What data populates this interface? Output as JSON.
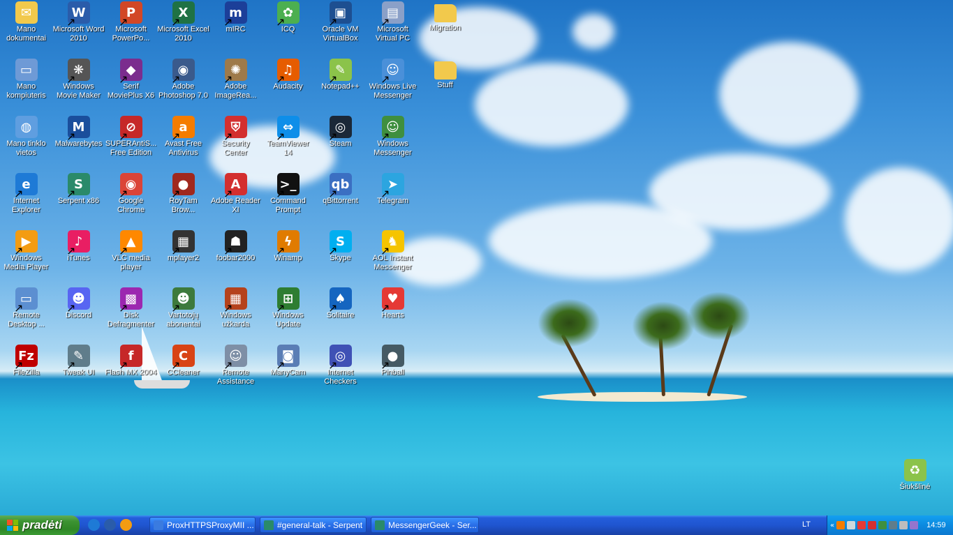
{
  "desktop": {
    "icons": [
      {
        "label": "Mano dokumentai",
        "icon": "folder-documents-icon",
        "color": "#f2c94c",
        "glyph": "✉"
      },
      {
        "label": "Microsoft Word 2010",
        "icon": "word-icon",
        "color": "#2a5caa",
        "glyph": "W"
      },
      {
        "label": "Microsoft PowerPo...",
        "icon": "powerpoint-icon",
        "color": "#d24726",
        "glyph": "P"
      },
      {
        "label": "Microsoft Excel 2010",
        "icon": "excel-icon",
        "color": "#1f7244",
        "glyph": "X"
      },
      {
        "label": "mIRC",
        "icon": "mirc-icon",
        "color": "#1c3f99",
        "glyph": "m"
      },
      {
        "label": "ICQ",
        "icon": "icq-icon",
        "color": "#4caf50",
        "glyph": "✿"
      },
      {
        "label": "Oracle VM VirtualBox",
        "icon": "virtualbox-icon",
        "color": "#1d4f91",
        "glyph": "▣"
      },
      {
        "label": "Microsoft Virtual PC",
        "icon": "virtual-pc-icon",
        "color": "#8aa0c8",
        "glyph": "▤"
      },
      {
        "label": "Migration",
        "icon": "folder-icon",
        "color": "#f2c94c",
        "glyph": ""
      },
      {
        "label": "Mano kompiuteris",
        "icon": "my-computer-icon",
        "color": "#6e9ad6",
        "glyph": "▭"
      },
      {
        "label": "Windows Movie Maker",
        "icon": "movie-maker-icon",
        "color": "#555555",
        "glyph": "❋"
      },
      {
        "label": "Serif MoviePlus X6",
        "icon": "movieplus-icon",
        "color": "#7b2d8e",
        "glyph": "◆"
      },
      {
        "label": "Adobe Photoshop 7.0",
        "icon": "photoshop-icon",
        "color": "#3a5a8c",
        "glyph": "◉"
      },
      {
        "label": "Adobe ImageRea...",
        "icon": "imageready-icon",
        "color": "#9e7a4a",
        "glyph": "✺"
      },
      {
        "label": "Audacity",
        "icon": "audacity-icon",
        "color": "#e65c00",
        "glyph": "♫"
      },
      {
        "label": "Notepad++",
        "icon": "notepadpp-icon",
        "color": "#8bc34a",
        "glyph": "✎"
      },
      {
        "label": "Windows Live Messenger",
        "icon": "live-messenger-icon",
        "color": "#4a90d9",
        "glyph": "☺"
      },
      {
        "label": "Stuff",
        "icon": "folder-icon",
        "color": "#f2c94c",
        "glyph": ""
      },
      {
        "label": "Mano tinklo vietos",
        "icon": "network-places-icon",
        "color": "#5f9ee0",
        "glyph": "◍"
      },
      {
        "label": "Malwarebytes",
        "icon": "malwarebytes-icon",
        "color": "#1a4e9c",
        "glyph": "M"
      },
      {
        "label": "SUPERAntiS... Free Edition",
        "icon": "superantispyware-icon",
        "color": "#c62828",
        "glyph": "⊘"
      },
      {
        "label": "Avast Free Antivirus",
        "icon": "avast-icon",
        "color": "#f57c00",
        "glyph": "a"
      },
      {
        "label": "Security Center",
        "icon": "security-center-icon",
        "color": "#d32f2f",
        "glyph": "⛨"
      },
      {
        "label": "TeamViewer 14",
        "icon": "teamviewer-icon",
        "color": "#0e8ee9",
        "glyph": "⇔"
      },
      {
        "label": "Steam",
        "icon": "steam-icon",
        "color": "#1b2838",
        "glyph": "◎"
      },
      {
        "label": "Windows Messenger",
        "icon": "windows-messenger-icon",
        "color": "#3f8f3f",
        "glyph": "☺"
      },
      {
        "label": "Internet Explorer",
        "icon": "internet-explorer-icon",
        "color": "#1e7ad6",
        "glyph": "e"
      },
      {
        "label": "Serpent x86",
        "icon": "serpent-icon",
        "color": "#2a8a6a",
        "glyph": "S"
      },
      {
        "label": "Google Chrome",
        "icon": "chrome-icon",
        "color": "#db4437",
        "glyph": "◉"
      },
      {
        "label": "RoyTam Brow...",
        "icon": "roytam-browser-icon",
        "color": "#a0281e",
        "glyph": "●"
      },
      {
        "label": "Adobe Reader XI",
        "icon": "adobe-reader-icon",
        "color": "#d32f2f",
        "glyph": "A"
      },
      {
        "label": "Command Prompt",
        "icon": "command-prompt-icon",
        "color": "#111111",
        "glyph": ">_"
      },
      {
        "label": "qBittorrent",
        "icon": "qbittorrent-icon",
        "color": "#3b6fc2",
        "glyph": "qb"
      },
      {
        "label": "Telegram",
        "icon": "telegram-icon",
        "color": "#2ca5e0",
        "glyph": "➤"
      },
      {
        "label": "Windows Media Player",
        "icon": "media-player-icon",
        "color": "#f39c12",
        "glyph": "▶"
      },
      {
        "label": "iTunes",
        "icon": "itunes-icon",
        "color": "#e91e63",
        "glyph": "♪"
      },
      {
        "label": "VLC media player",
        "icon": "vlc-icon",
        "color": "#ff8800",
        "glyph": "▲"
      },
      {
        "label": "mplayer2",
        "icon": "mplayer2-icon",
        "color": "#333333",
        "glyph": "▦"
      },
      {
        "label": "foobar2000",
        "icon": "foobar2000-icon",
        "color": "#222222",
        "glyph": "☗"
      },
      {
        "label": "Winamp",
        "icon": "winamp-icon",
        "color": "#e07b00",
        "glyph": "ϟ"
      },
      {
        "label": "Skype",
        "icon": "skype-icon",
        "color": "#00aff0",
        "glyph": "S"
      },
      {
        "label": "AOL Instant Messenger",
        "icon": "aim-icon",
        "color": "#f5c400",
        "glyph": "♞"
      },
      {
        "label": "Remote Desktop ...",
        "icon": "remote-desktop-icon",
        "color": "#5c8fd1",
        "glyph": "▭"
      },
      {
        "label": "Discord",
        "icon": "discord-icon",
        "color": "#5865f2",
        "glyph": "☻"
      },
      {
        "label": "Disk Defragmenter",
        "icon": "defragmenter-icon",
        "color": "#9c27b0",
        "glyph": "▩"
      },
      {
        "label": "Vartotojų abonentai",
        "icon": "user-accounts-icon",
        "color": "#3d7a3d",
        "glyph": "☻"
      },
      {
        "label": "Windows užkarda",
        "icon": "firewall-icon",
        "color": "#b5421c",
        "glyph": "▦"
      },
      {
        "label": "Windows Update",
        "icon": "windows-update-icon",
        "color": "#2e7d32",
        "glyph": "⊞"
      },
      {
        "label": "Solitaire",
        "icon": "solitaire-icon",
        "color": "#1565c0",
        "glyph": "♠"
      },
      {
        "label": "Hearts",
        "icon": "hearts-icon",
        "color": "#e53935",
        "glyph": "♥"
      },
      {
        "label": "FileZilla",
        "icon": "filezilla-icon",
        "color": "#bf0000",
        "glyph": "Fz"
      },
      {
        "label": "Tweak UI",
        "icon": "tweak-ui-icon",
        "color": "#607d8b",
        "glyph": "✎"
      },
      {
        "label": "Flash MX 2004",
        "icon": "flash-icon",
        "color": "#c62828",
        "glyph": "f"
      },
      {
        "label": "CCleaner",
        "icon": "ccleaner-icon",
        "color": "#d84315",
        "glyph": "C"
      },
      {
        "label": "Remote Assistance",
        "icon": "remote-assistance-icon",
        "color": "#7e8fa6",
        "glyph": "☺"
      },
      {
        "label": "ManyCam",
        "icon": "manycam-icon",
        "color": "#5a7db5",
        "glyph": "◙"
      },
      {
        "label": "Internet Checkers",
        "icon": "internet-checkers-icon",
        "color": "#3f51b5",
        "glyph": "◎"
      },
      {
        "label": "Pinball",
        "icon": "pinball-icon",
        "color": "#455a64",
        "glyph": "●"
      },
      {
        "label": "Šiukšlinė",
        "icon": "recycle-bin-icon",
        "color": "#8bc34a",
        "glyph": "♻"
      }
    ]
  },
  "taskbar": {
    "start_label": "pradėti",
    "quick_launch": [
      {
        "icon": "internet-explorer-icon",
        "color": "#1e7ad6"
      },
      {
        "icon": "outlook-express-icon",
        "color": "#2a5caa"
      },
      {
        "icon": "media-player-icon",
        "color": "#f39c12"
      }
    ],
    "tasks": [
      {
        "label": "ProxHTTPSProxyMII ...",
        "icon": "app-window-icon",
        "color": "#3a7be0"
      },
      {
        "label": "#general-talk - Serpent",
        "icon": "serpent-icon",
        "color": "#2a8a6a"
      },
      {
        "label": "MessengerGeek - Ser...",
        "icon": "serpent-icon",
        "color": "#2a8a6a"
      }
    ],
    "language": "LT",
    "tray_icons": [
      {
        "icon": "avast-tray-icon",
        "color": "#f57c00"
      },
      {
        "icon": "network-tray-icon",
        "color": "#cfd8dc"
      },
      {
        "icon": "network-warning-tray-icon",
        "color": "#e53935"
      },
      {
        "icon": "security-tray-icon",
        "color": "#d32f2f"
      },
      {
        "icon": "messenger-tray-icon",
        "color": "#3f8f3f"
      },
      {
        "icon": "hardware-tray-icon",
        "color": "#607d8b"
      },
      {
        "icon": "volume-tray-icon",
        "color": "#bdbdbd"
      },
      {
        "icon": "pen-tray-icon",
        "color": "#9575cd"
      }
    ],
    "chevron": "«",
    "clock": "14:59"
  }
}
